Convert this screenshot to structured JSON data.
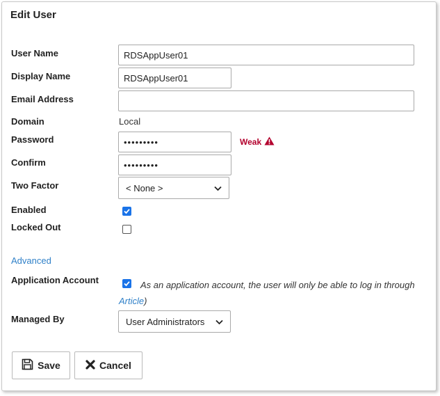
{
  "dialog": {
    "title": "Edit User"
  },
  "fields": {
    "user_name": {
      "label": "User Name",
      "value": "RDSAppUser01"
    },
    "display_name": {
      "label": "Display Name",
      "value": "RDSAppUser01"
    },
    "email": {
      "label": "Email Address",
      "value": ""
    },
    "domain": {
      "label": "Domain",
      "value": "Local"
    },
    "password": {
      "label": "Password",
      "value": "•••••••••",
      "strength": "Weak",
      "strength_color": "#b3002d"
    },
    "confirm": {
      "label": "Confirm",
      "value": "•••••••••"
    },
    "two_factor": {
      "label": "Two Factor",
      "value": "< None >"
    },
    "enabled": {
      "label": "Enabled",
      "checked": true
    },
    "locked_out": {
      "label": "Locked Out",
      "checked": false
    }
  },
  "advanced": {
    "label": "Advanced"
  },
  "application_account": {
    "label": "Application Account",
    "checked": true,
    "description": "As an application account, the user will only be able to log in through",
    "link": "Article",
    "suffix": ")"
  },
  "managed_by": {
    "label": "Managed By",
    "value": "User Administrators"
  },
  "buttons": {
    "save": "Save",
    "cancel": "Cancel"
  },
  "colors": {
    "accent": "#1a73e8",
    "link": "#2f80c8",
    "warning": "#b3002d"
  }
}
